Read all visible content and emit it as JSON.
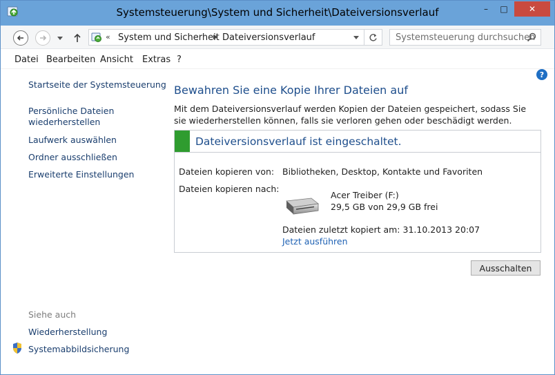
{
  "window": {
    "title": "Systemsteuerung\\System und Sicherheit\\Dateiversionsverlauf",
    "controls": {
      "minimize": "–",
      "maximize": "□",
      "close": "✕"
    }
  },
  "address": {
    "overflow": "«",
    "crumbs": [
      "System und Sicherheit",
      "Dateiversionsverlauf"
    ],
    "separator": "▶"
  },
  "search": {
    "placeholder": "Systemsteuerung durchsuchen"
  },
  "menu": [
    "Datei",
    "Bearbeiten",
    "Ansicht",
    "Extras",
    "?"
  ],
  "help": {
    "glyph": "?"
  },
  "sidebar": {
    "links": [
      "Startseite der Systemsteuerung",
      "Persönliche Dateien wiederherstellen",
      "Laufwerk auswählen",
      "Ordner ausschließen",
      "Erweiterte Einstellungen"
    ],
    "see_also_heading": "Siehe auch",
    "see_also": [
      "Wiederherstellung",
      "Systemabbildsicherung"
    ]
  },
  "main": {
    "heading": "Bewahren Sie eine Kopie Ihrer Dateien auf",
    "description": "Mit dem Dateiversionsverlauf werden Kopien der Dateien gespeichert, sodass Sie sie wiederherstellen können, falls sie verloren gehen oder beschädigt werden.",
    "status": "Dateiversionsverlauf ist eingeschaltet.",
    "status_color": "#2f9c2f",
    "copy_from_label": "Dateien kopieren von:",
    "copy_from_value": "Bibliotheken, Desktop, Kontakte und Favoriten",
    "copy_to_label": "Dateien kopieren nach:",
    "drive_name": "Acer Treiber (F:)",
    "drive_space": "29,5 GB von 29,9 GB frei",
    "last_copied": "Dateien zuletzt kopiert am: 31.10.2013 20:07",
    "run_now": "Jetzt ausführen",
    "turn_off_button": "Ausschalten"
  }
}
